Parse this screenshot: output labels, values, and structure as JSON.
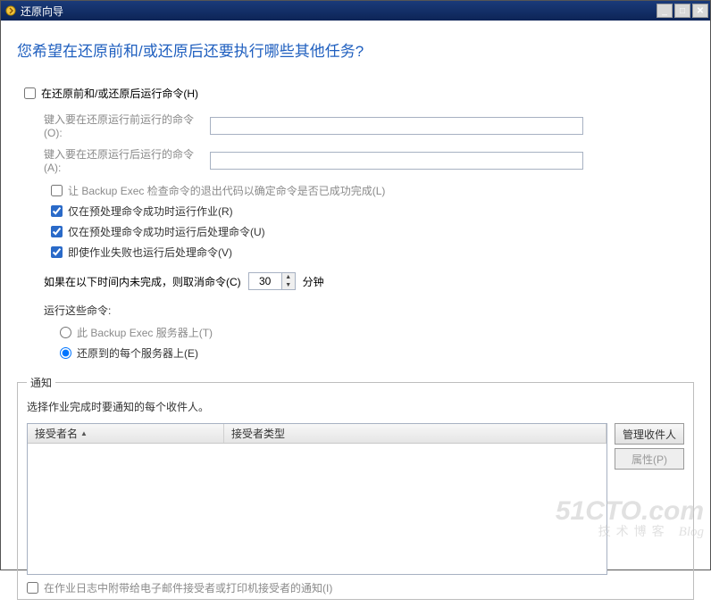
{
  "window": {
    "title": "还原向导"
  },
  "heading": "您希望在还原前和/或还原后还要执行哪些其他任务?",
  "pre_post_group": {
    "run_cmds_label": "在还原前和/或还原后运行命令(H)",
    "run_cmds_checked": false,
    "before_label": "键入要在还原运行前运行的命令(O):",
    "before_value": "",
    "after_label": "键入要在还原运行后运行的命令(A):",
    "after_value": "",
    "opt_check_exit_label": "让 Backup Exec 检查命令的退出代码以确定命令是否已成功完成(L)",
    "opt_check_exit_checked": false,
    "opt_only_if_pre_label": "仅在预处理命令成功时运行作业(R)",
    "opt_only_if_pre_checked": true,
    "opt_only_if_pre_post_label": "仅在预处理命令成功时运行后处理命令(U)",
    "opt_only_if_pre_post_checked": true,
    "opt_even_fail_label": "即使作业失败也运行后处理命令(V)",
    "opt_even_fail_checked": true,
    "timeout_prefix": "如果在以下时间内未完成，则取消命令(C)",
    "timeout_value": "30",
    "timeout_suffix": "分钟",
    "run_location_title": "运行这些命令:",
    "radio_this_server_label": "此 Backup Exec 服务器上(T)",
    "radio_each_server_label": "还原到的每个服务器上(E)",
    "radio_selected": "each"
  },
  "notify": {
    "legend": "通知",
    "desc": "选择作业完成时要通知的每个收件人。",
    "col_name": "接受者名",
    "col_type": "接受者类型",
    "manage_btn": "管理收件人",
    "props_btn": "属性(P)",
    "attach_label": "在作业日志中附带给电子邮件接受者或打印机接受者的通知(I)",
    "attach_checked": false
  },
  "watermark": {
    "l1": "51CTO.com",
    "l2": "技术博客",
    "l3": "Blog"
  }
}
